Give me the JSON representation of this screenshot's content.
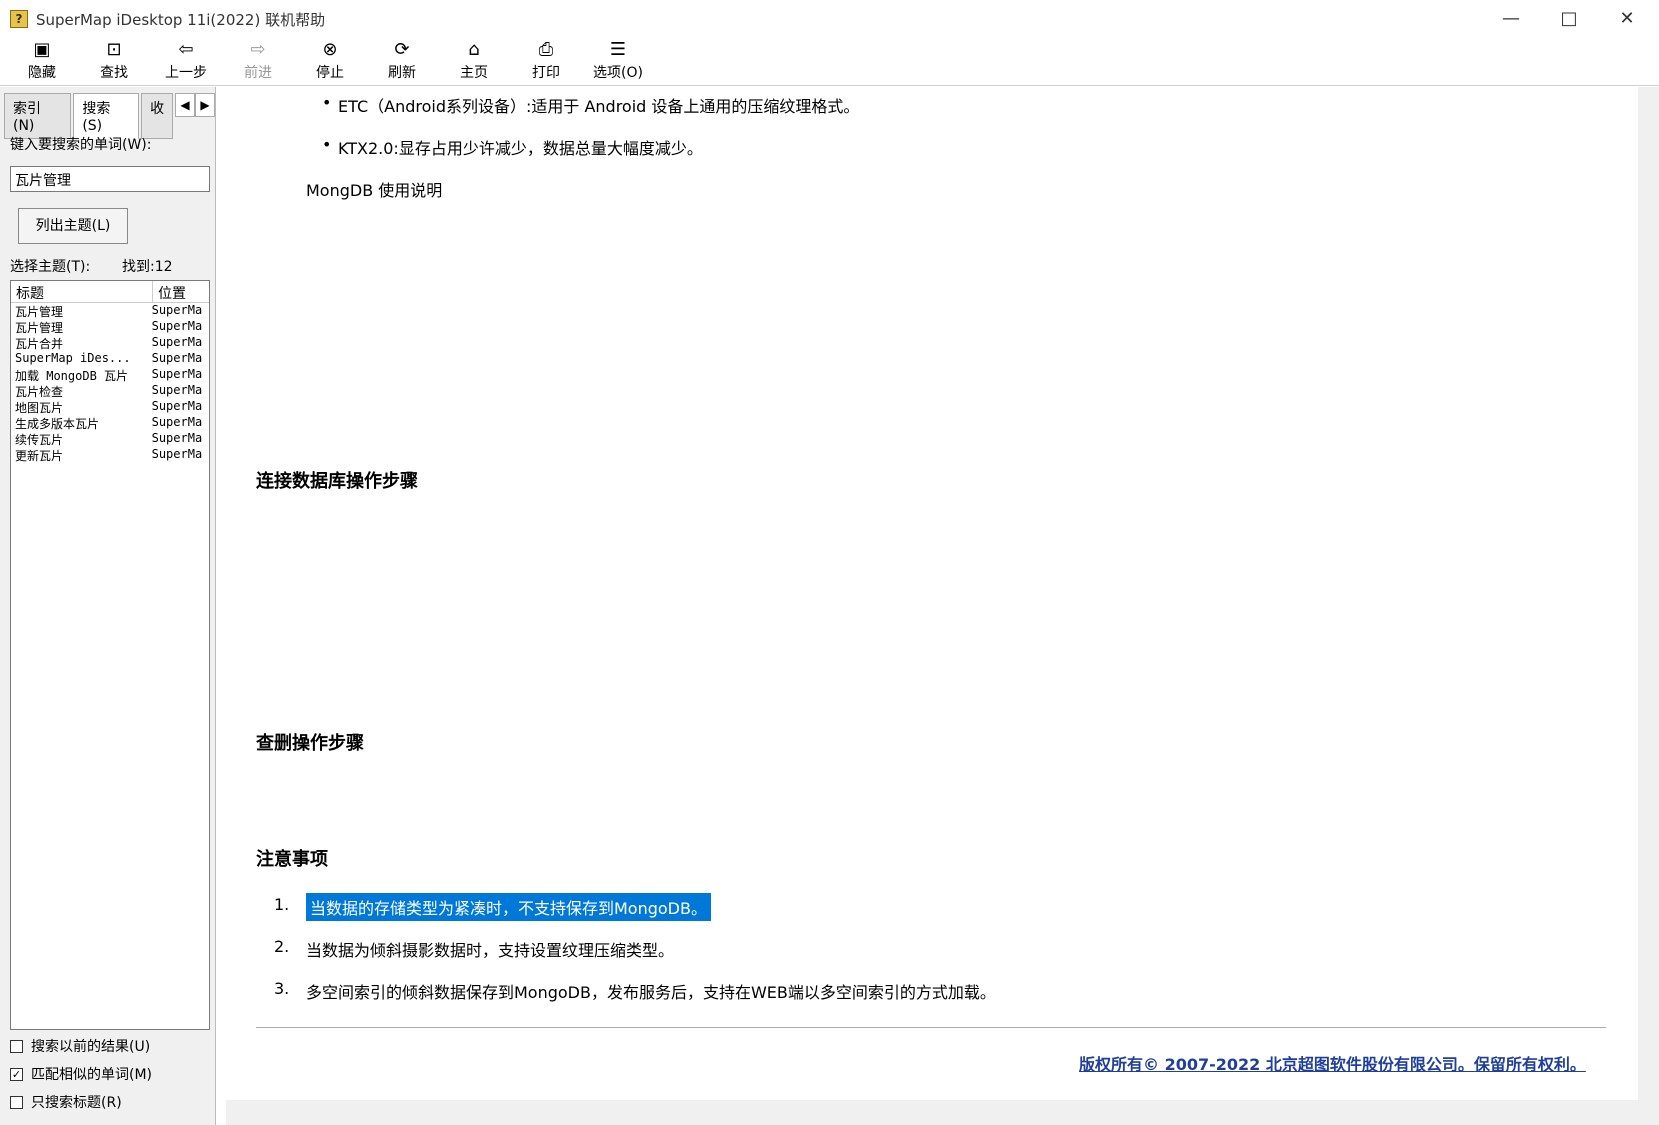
{
  "title": "SuperMap iDesktop 11i(2022) 联机帮助",
  "tb": [
    "隐藏",
    "查找",
    "上一步",
    "前进",
    "停止",
    "刷新",
    "主页",
    "打印",
    "选项(O)"
  ],
  "tabs": [
    "索引(N)",
    "搜索(S)",
    "收"
  ],
  "kw": "键入要搜索的单词(W):",
  "q": "瓦片管理",
  "lbtn": "列出主题(L)",
  "sel": "选择主题(T):",
  "found": "找到:12",
  "cols": [
    "标题",
    "位置"
  ],
  "rows": [
    "瓦片管理",
    "瓦片管理",
    "瓦片合并",
    "SuperMap iDes...",
    "加载 MongoDB 瓦片",
    "瓦片检查",
    "地图瓦片",
    "生成多版本瓦片",
    "续传瓦片",
    "更新瓦片"
  ],
  "loc": "SuperMa",
  "cbs": [
    "搜索以前的结果(U)",
    "匹配相似的单词(M)",
    "只搜索标题(R)"
  ],
  "p1": "ETC（Android系列设备）:适用于 Android 设备上通用的压缩纹理格式。",
  "p2": "KTX2.0:显存占用少许减少，数据总量大幅度减少。",
  "h1": "连接数据库操作步骤",
  "h2": "查删操作步骤",
  "h3": "注意事项",
  "n1": "当数据的存储类型为紧凑时，不支持保存到MongoDB。",
  "n2": "当数据为倾斜摄影数据时，支持设置纹理压缩类型。",
  "n3": "多空间索引的倾斜数据保存到MongoDB，发布服务后，支持在WEB端以多空间索引的方式加载。",
  "copy": "版权所有© 2007-2022 北京超图软件股份有限公司。保留所有权利。",
  "link": "MongDB 使用说明"
}
